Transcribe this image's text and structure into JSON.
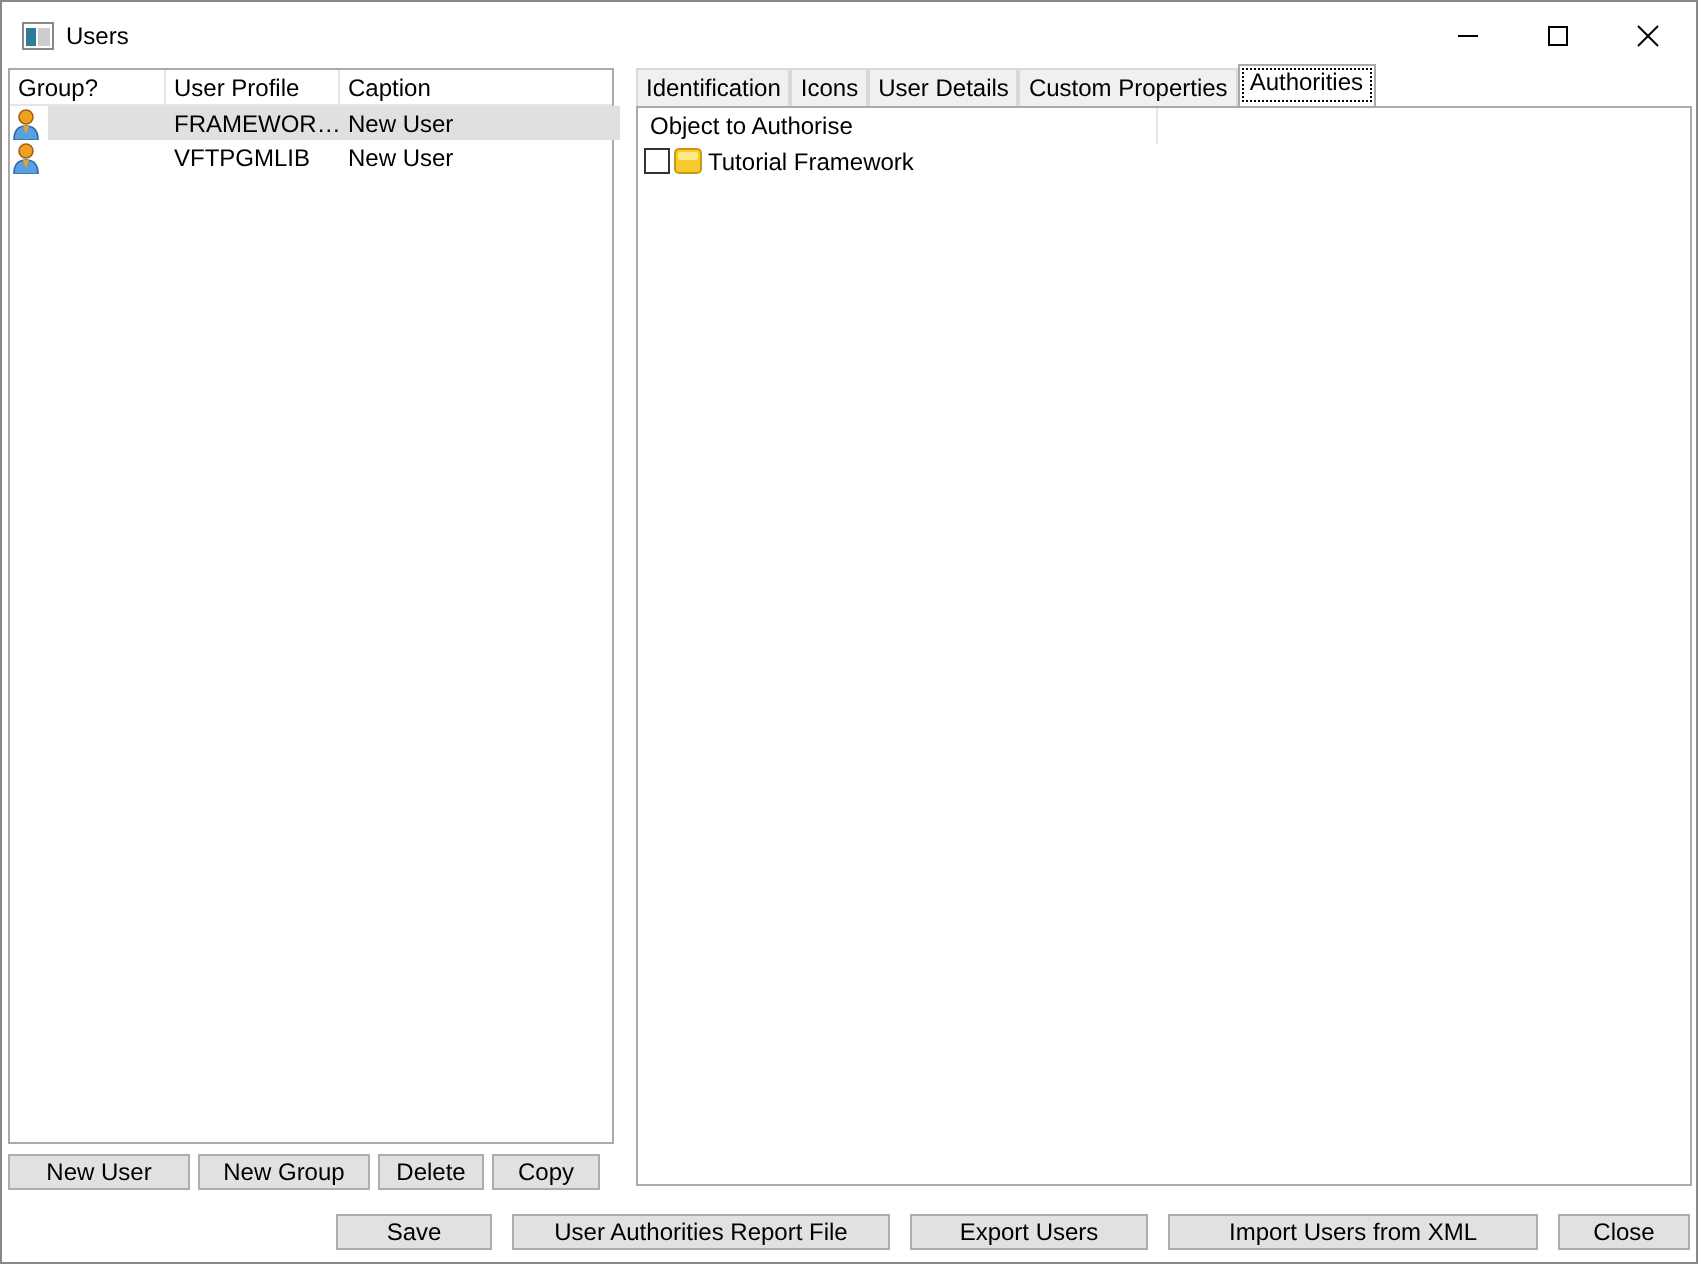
{
  "window": {
    "title": "Users"
  },
  "users": {
    "columns": [
      "Group?",
      "User Profile",
      "Caption"
    ],
    "rows": [
      {
        "profile": "FRAMEWOR…",
        "caption": "New User",
        "selected": true
      },
      {
        "profile": "VFTPGMLIB",
        "caption": "New User",
        "selected": false
      }
    ]
  },
  "user_buttons": [
    "New User",
    "New Group",
    "Delete",
    "Copy"
  ],
  "tabs": [
    {
      "label": "Identification",
      "selected": false
    },
    {
      "label": "Icons",
      "selected": false
    },
    {
      "label": "User Details",
      "selected": false
    },
    {
      "label": "Custom Properties",
      "selected": false
    },
    {
      "label": "Authorities",
      "selected": true
    }
  ],
  "authorities": {
    "column": "Object to Authorise",
    "items": [
      {
        "label": "Tutorial Framework",
        "checked": false
      }
    ]
  },
  "buttons": [
    "Save",
    "User Authorities Report File",
    "Export Users",
    "Import Users from XML",
    "Close"
  ]
}
